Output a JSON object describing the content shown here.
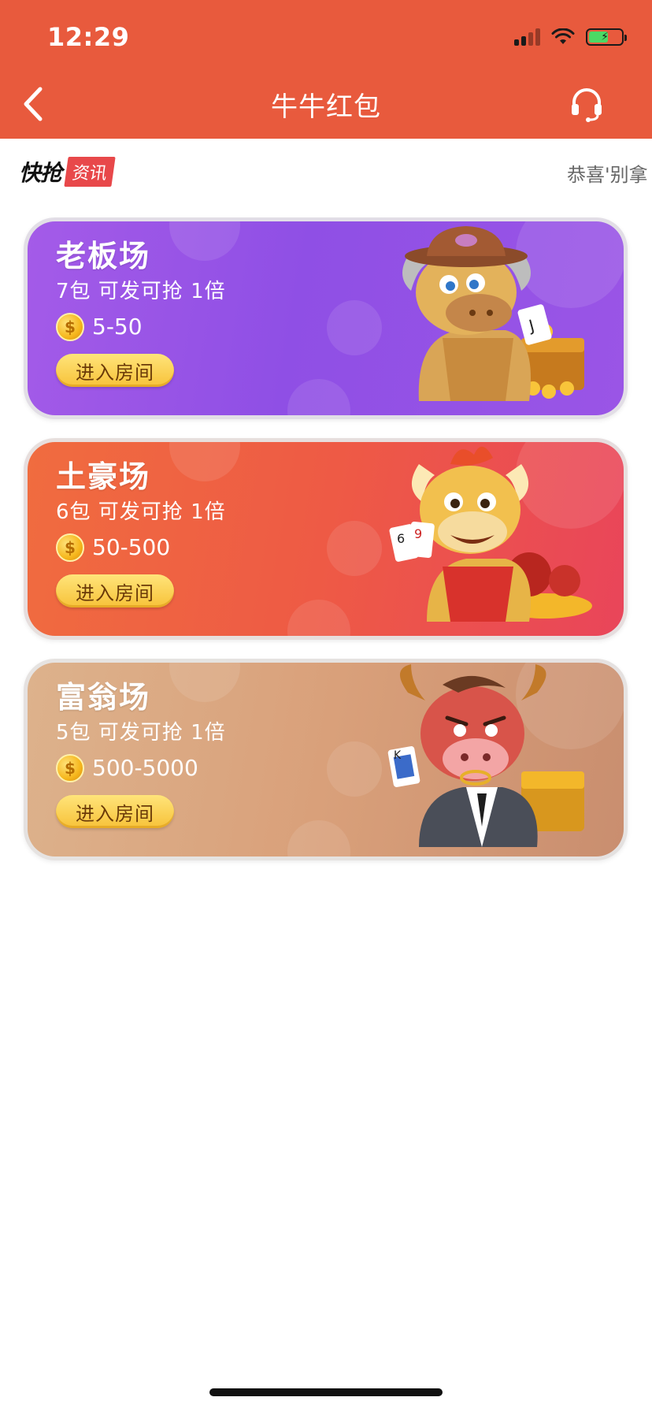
{
  "status_bar": {
    "time": "12:29"
  },
  "nav": {
    "title": "牛牛红包",
    "back_icon": "chevron-left-icon",
    "support_icon": "headset-icon"
  },
  "ticker": {
    "logo_main": "快抢",
    "logo_tag": "资讯",
    "text": "恭喜'别拿"
  },
  "rooms": [
    {
      "title": "老板场",
      "desc": "7包 可发可抢 1倍",
      "range": "5-50",
      "button": "进入房间",
      "mascot": "cowboy-bull-with-treasure"
    },
    {
      "title": "土豪场",
      "desc": "6包 可发可抢 1倍",
      "range": "50-500",
      "button": "进入房间",
      "mascot": "happy-bull-with-cards"
    },
    {
      "title": "富翁场",
      "desc": "5包 可发可抢 1倍",
      "range": "500-5000",
      "button": "进入房间",
      "mascot": "tycoon-bull-in-suit"
    }
  ],
  "colors": {
    "header": "#E85A3D",
    "boss_card": "#9A55E6",
    "tyrant_card": "#EE5A45",
    "rich_card": "#D9A07A",
    "button": "#F7C239"
  }
}
